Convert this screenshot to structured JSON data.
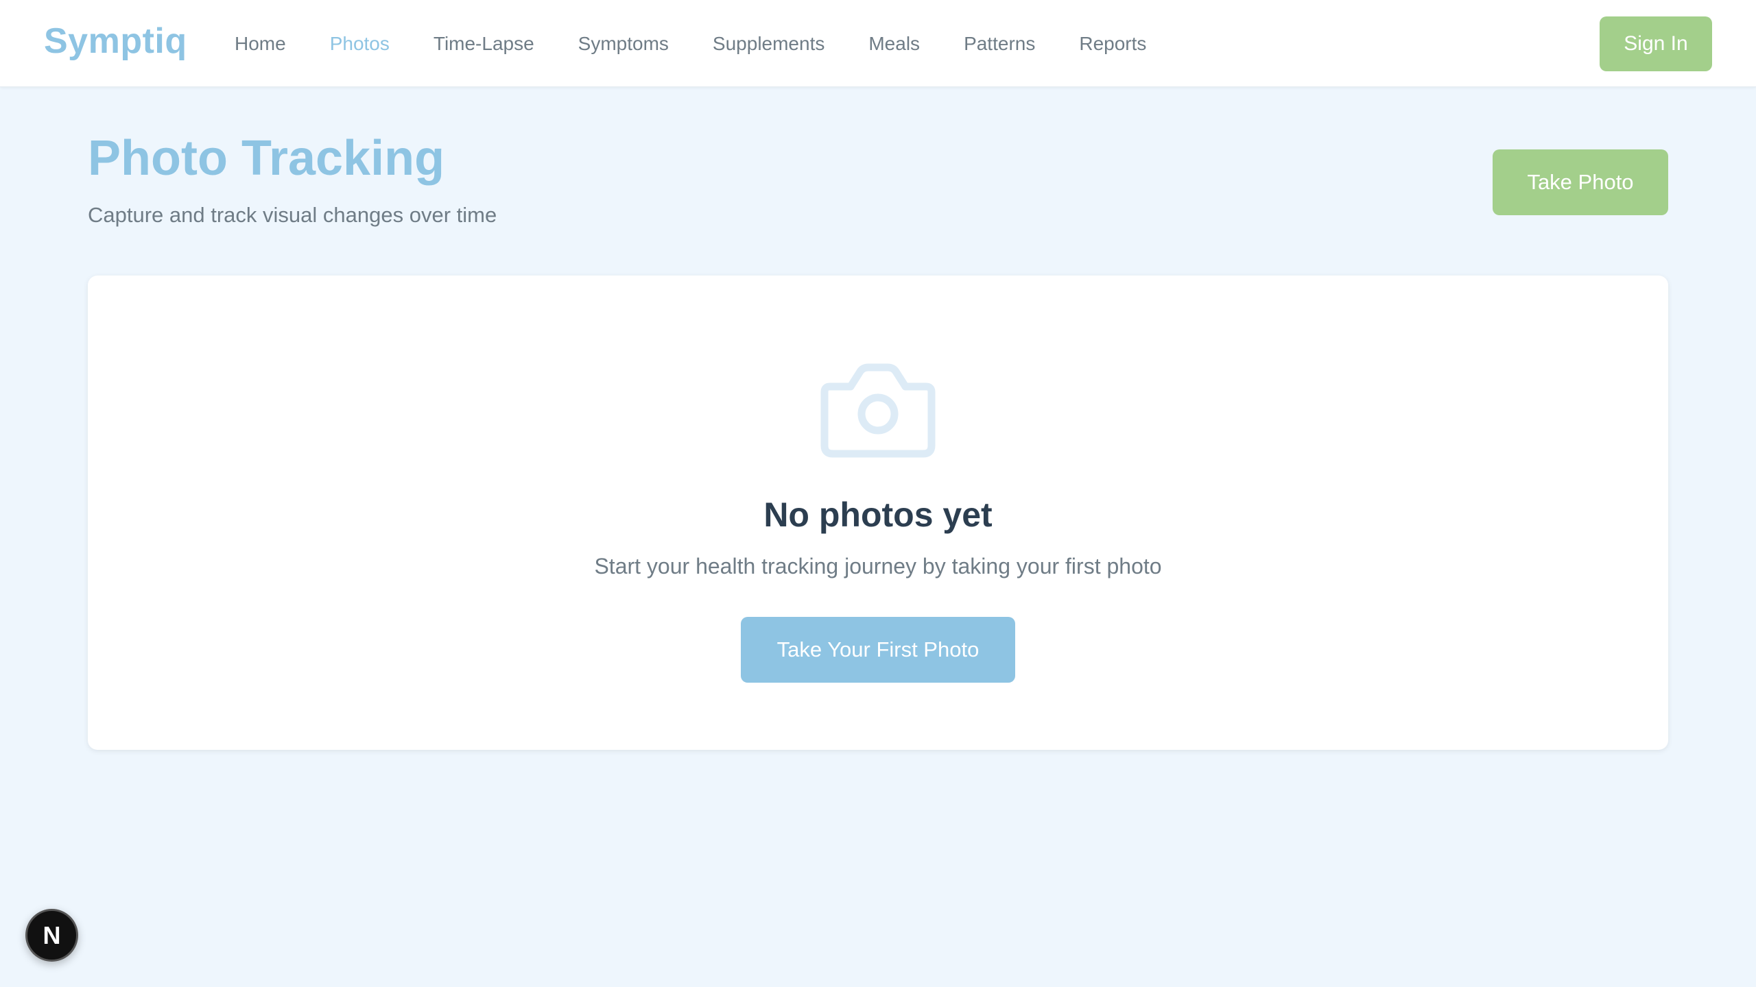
{
  "brand": "Symptiq",
  "nav": {
    "items": [
      {
        "label": "Home"
      },
      {
        "label": "Photos"
      },
      {
        "label": "Time-Lapse"
      },
      {
        "label": "Symptoms"
      },
      {
        "label": "Supplements"
      },
      {
        "label": "Meals"
      },
      {
        "label": "Patterns"
      },
      {
        "label": "Reports"
      }
    ],
    "active": "Photos",
    "signin_label": "Sign In"
  },
  "header": {
    "title": "Photo Tracking",
    "subtitle": "Capture and track visual changes over time",
    "take_photo_label": "Take Photo"
  },
  "empty_state": {
    "icon": "camera-icon",
    "title": "No photos yet",
    "text": "Start your health tracking journey by taking your first photo",
    "button_label": "Take Your First Photo"
  },
  "dev_badge": {
    "letter": "N"
  },
  "colors": {
    "accent_blue": "#8ec4e3",
    "accent_green": "#a3cf8b",
    "background": "#eef6fd",
    "heading_dark": "#2c3e50",
    "muted_text": "#6f7c86"
  }
}
